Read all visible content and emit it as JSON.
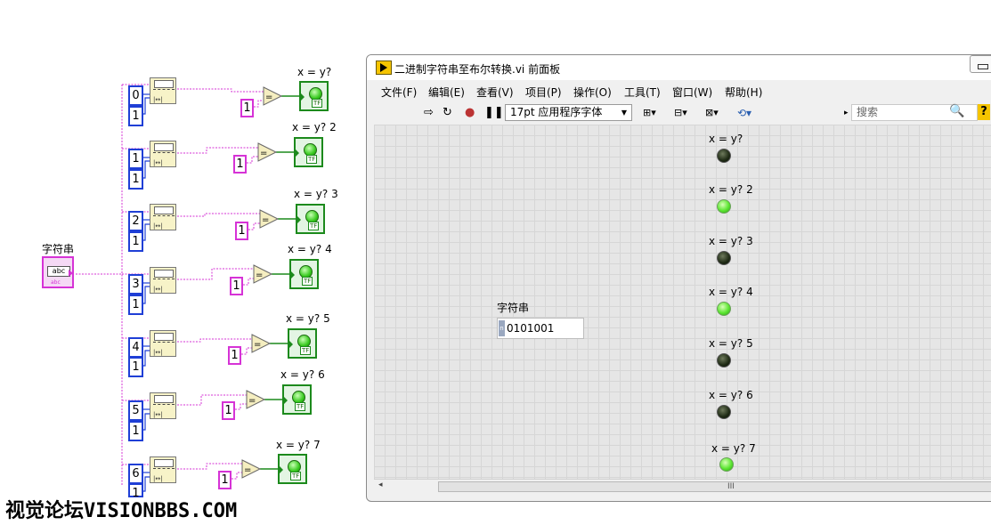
{
  "block_diagram": {
    "string_control_label": "字符串",
    "string_control_icon_text": "abc",
    "string_control_sub_text": "abc",
    "rows": [
      {
        "index": "0",
        "length": "1",
        "compare_const": "1",
        "indicator_label": "x = y?"
      },
      {
        "index": "1",
        "length": "1",
        "compare_const": "1",
        "indicator_label": "x = y? 2"
      },
      {
        "index": "2",
        "length": "1",
        "compare_const": "1",
        "indicator_label": "x = y? 3"
      },
      {
        "index": "3",
        "length": "1",
        "compare_const": "1",
        "indicator_label": "x = y? 4"
      },
      {
        "index": "4",
        "length": "1",
        "compare_const": "1",
        "indicator_label": "x = y? 5"
      },
      {
        "index": "5",
        "length": "1",
        "compare_const": "1",
        "indicator_label": "x = y? 6"
      },
      {
        "index": "6",
        "length": "1",
        "compare_const": "1",
        "indicator_label": "x = y? 7"
      }
    ],
    "equal_symbol": "=",
    "indicator_tf": "TF"
  },
  "watermark": "视觉论坛VISIONBBS.COM",
  "window": {
    "title": "二进制字符串至布尔转换.vi 前面板",
    "menu": [
      "文件(F)",
      "编辑(E)",
      "查看(V)",
      "项目(P)",
      "操作(O)",
      "工具(T)",
      "窗口(W)",
      "帮助(H)"
    ],
    "toolbar": {
      "font_select": "17pt 应用程序字体",
      "search_placeholder": "搜索",
      "help": "?"
    },
    "front_panel": {
      "string_label": "字符串",
      "string_value": "0101001",
      "radix_glyph": "n",
      "indicators": [
        {
          "label": "x = y?",
          "state": "off"
        },
        {
          "label": "x = y? 2",
          "state": "on"
        },
        {
          "label": "x = y? 3",
          "state": "off"
        },
        {
          "label": "x = y? 4",
          "state": "on"
        },
        {
          "label": "x = y? 5",
          "state": "off"
        },
        {
          "label": "x = y? 6",
          "state": "off"
        },
        {
          "label": "x = y? 7",
          "state": "on"
        }
      ]
    },
    "scrollbar_grip": "III"
  },
  "colors": {
    "string_wire": "#d633d6",
    "index_const": "#1f3fd6",
    "bool_terminal": "#1c8a1c",
    "led_on": "#5ce632",
    "led_off": "#1e2a14"
  }
}
